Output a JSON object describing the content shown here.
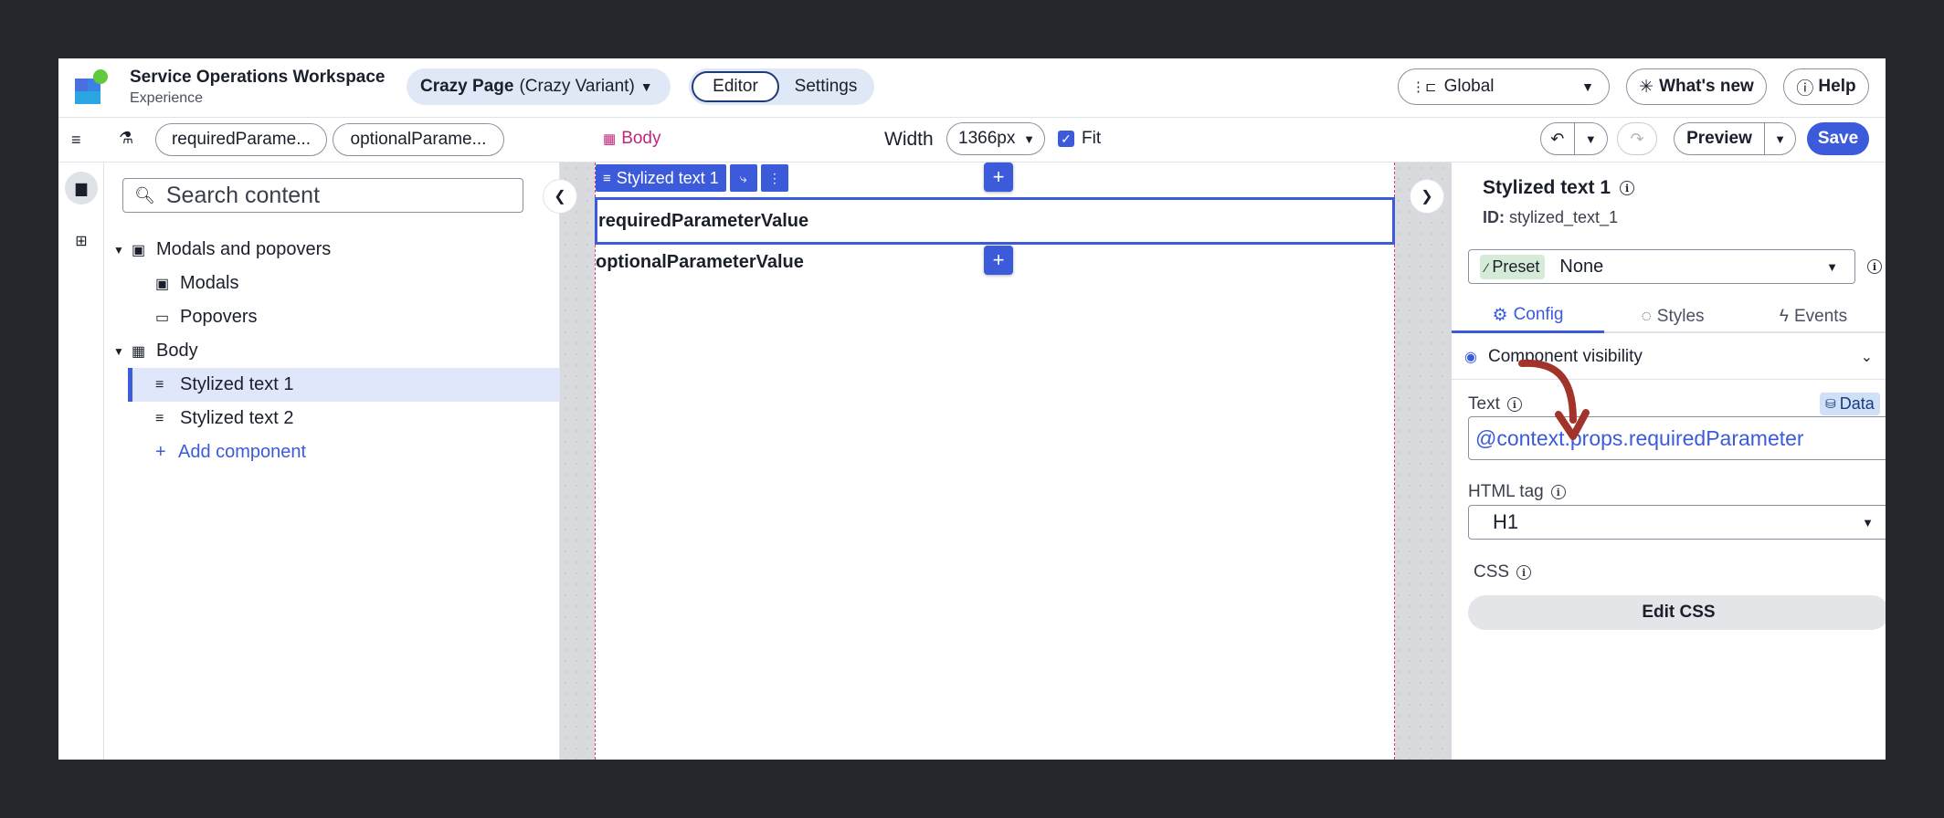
{
  "header": {
    "app_title": "Service Operations Workspace",
    "app_subtitle": "Experience",
    "page_name": "Crazy Page",
    "page_variant": "(Crazy Variant)",
    "tabs": [
      "Editor",
      "Settings"
    ],
    "scope_select": "Global",
    "whats_new": "What's new",
    "help": "Help"
  },
  "toolbar": {
    "params": [
      "requiredParame...",
      "optionalParame..."
    ],
    "breadcrumb": "Body",
    "width_label": "Width",
    "width_value": "1366px",
    "fit_label": "Fit",
    "fit_checked": true,
    "preview_label": "Preview",
    "save_label": "Save"
  },
  "tree": {
    "search_placeholder": "Search content",
    "items": [
      {
        "label": "Modals and popovers",
        "icon": "modal-icon"
      },
      {
        "label": "Modals",
        "icon": "modal-icon"
      },
      {
        "label": "Popovers",
        "icon": "popover-icon"
      },
      {
        "label": "Body",
        "icon": "layout-icon"
      },
      {
        "label": "Stylized text 1",
        "icon": "text-lines-icon"
      },
      {
        "label": "Stylized text 2",
        "icon": "text-lines-icon"
      },
      {
        "label": "Add component",
        "icon": "plus-icon"
      }
    ]
  },
  "canvas": {
    "selected_label": "Stylized text 1",
    "text1": "requiredParameterValue",
    "text2": "optionalParameterValue"
  },
  "config": {
    "title": "Stylized text 1",
    "id_label": "ID:",
    "id_value": "stylized_text_1",
    "preset_badge": "Preset",
    "preset_value": "None",
    "tabs": [
      "Config",
      "Styles",
      "Events"
    ],
    "visibility_label": "Component visibility",
    "text_label": "Text",
    "data_badge": "Data",
    "text_value": "@context.props.requiredParameter",
    "html_tag_label": "HTML tag",
    "html_tag_value": "H1",
    "css_label": "CSS",
    "edit_css": "Edit CSS"
  },
  "colors": {
    "accent": "#3b5bdb",
    "body_crumb": "#c0267a",
    "arrow": "#a2332a",
    "background": "#24262b"
  }
}
